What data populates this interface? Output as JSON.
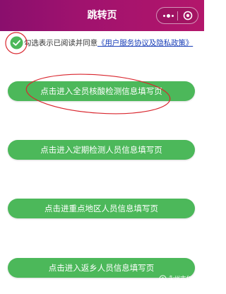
{
  "header": {
    "title": "跳转页",
    "more_icon": "more-dots-icon",
    "close_icon": "target-circle-icon",
    "bg_color": "#a0126e"
  },
  "agreement": {
    "checked": true,
    "text": "勾选表示已阅读并同意",
    "link": "《用户服务协议及隐私政策》"
  },
  "buttons": [
    {
      "label": "点击进入全员核酸检测信息填写页"
    },
    {
      "label": "点击进入定期检测人员信息填写页"
    },
    {
      "label": "点击进重点地区人员信息填写页"
    },
    {
      "label": "点击进入返乡人员信息填写页"
    }
  ],
  "colors": {
    "button_green": "#4cb85a",
    "link_blue": "#1a3fb8",
    "annotation_red": "#d9262e"
  },
  "watermark": {
    "text": "永州市仁手"
  }
}
